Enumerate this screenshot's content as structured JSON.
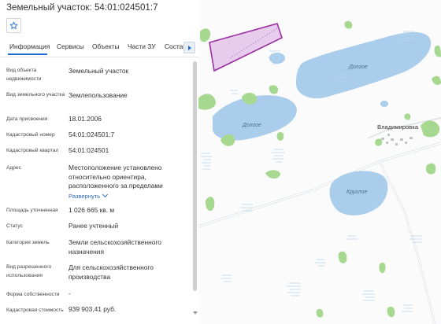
{
  "header": {
    "title": "Земельный участок: 54:01:024501:7"
  },
  "tabs": [
    {
      "label": "Информация",
      "active": true
    },
    {
      "label": "Сервисы"
    },
    {
      "label": "Объекты"
    },
    {
      "label": "Части ЗУ"
    },
    {
      "label": "Состав"
    }
  ],
  "fields": [
    {
      "label": "Вид объекта недвижимости",
      "value": "Земельный участок"
    },
    {
      "label": "Вид земельного участка",
      "value": "Землепользование"
    },
    {
      "label": "Дата присвоения",
      "value": "18.01.2006"
    },
    {
      "label": "Кадастровый номер",
      "value": "54:01:024501:7"
    },
    {
      "label": "Кадастровый квартал",
      "value": "54:01:024501"
    },
    {
      "label": "Адрес",
      "value": "Местоположение установлено относительно ориентира, расположенного за пределами",
      "expand": "Развернуть"
    },
    {
      "label": "Площадь уточненная",
      "value": "1 026 665 кв. м"
    },
    {
      "label": "Статус",
      "value": "Ранее учтенный"
    },
    {
      "label": "Категория земель",
      "value": "Земли сельскохозяйственного назначения"
    },
    {
      "label": "Вид разрешенного использования",
      "value": "Для сельскохозяйственного производства"
    },
    {
      "label": "Форма собственности",
      "value": "-"
    },
    {
      "label": "Кадастровая стоимость",
      "value": "939 903,41 руб."
    }
  ],
  "map": {
    "labels": {
      "lake_dolgoe_1": "Долгое",
      "lake_dolgoe_2": "Долгое",
      "lake_krugloe": "Круглое",
      "village": "Владимировка"
    },
    "colors": {
      "water": "#a9cdea",
      "forest": "#a7d890",
      "parcel_stroke": "#9a2fa0",
      "parcel_fill": "#e6c6ec",
      "accent": "#1f6fd1"
    }
  },
  "icons": {
    "favorite": "star-icon",
    "tabs_scroll": "chevron-right-icon"
  }
}
